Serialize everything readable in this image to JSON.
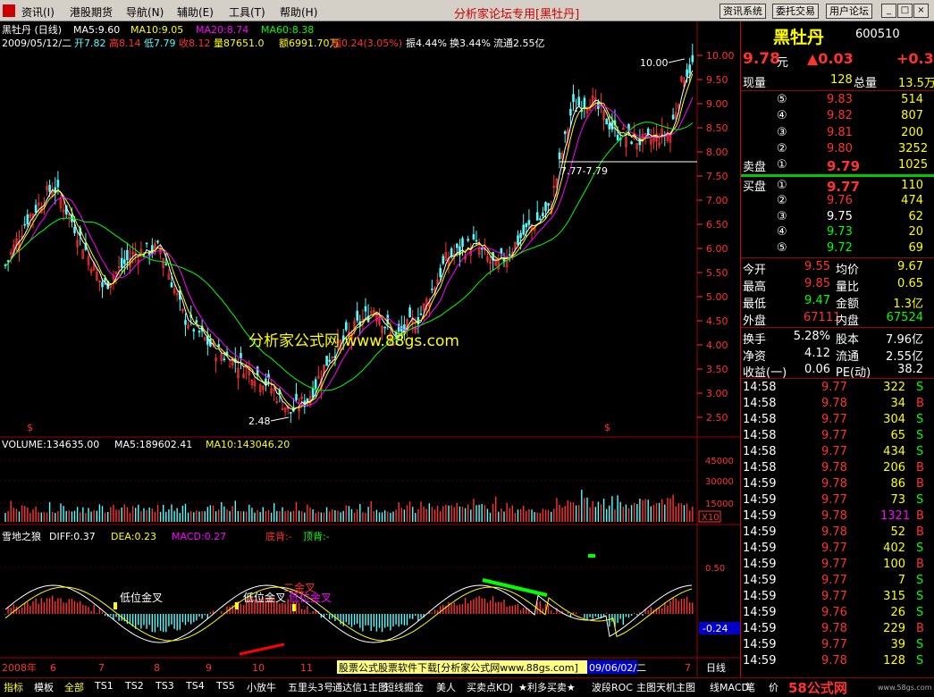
{
  "menu": {
    "items": [
      "资讯(I)",
      "港股期货",
      "导航(N)",
      "辅助(E)",
      "工具(T)",
      "帮助(H)"
    ],
    "title_prefix": "分析家论坛专用",
    "title_stock": "[黑牡丹]",
    "buttons": [
      "资讯系统",
      "委托交易",
      "用户论坛"
    ],
    "window_buttons": [
      "_",
      "□",
      "×"
    ]
  },
  "price_panel": {
    "line1": {
      "name": "黑牡丹  (日线)",
      "ma5": "MA5:9.60",
      "ma10": "MA10:9.05",
      "ma20": "MA20:8.74",
      "ma60": "MA60:8.38"
    },
    "line2": {
      "date": "2009/05/12/二",
      "open": "开7.82",
      "high": "高8.14",
      "low": "低7.79",
      "close": "收8.12",
      "volume": "量87651.0",
      "amount": "额6991.70万",
      "range": "幅0.24(3.05%)",
      "amplitude": "振4.44%",
      "turnover": "换3.44%",
      "float": "流通2.55亿"
    },
    "annotations": {
      "high_mark": "10.00",
      "low_mark": "2.48",
      "range_box": "7.77-7.79",
      "watermark": "分析家公式网 www.88gs.com",
      "dollar_left": "$",
      "dollar_right": "$"
    },
    "y_ticks": [
      "10.00",
      "9.50",
      "9.00",
      "8.50",
      "8.00",
      "7.50",
      "7.00",
      "6.50",
      "6.00",
      "5.50",
      "5.00",
      "4.50",
      "4.00",
      "3.50",
      "3.00",
      "2.50"
    ]
  },
  "volume_panel": {
    "label": "VOLUME:134635.00",
    "ma5": "MA5:189602.41",
    "ma10": "MA10:143046.20",
    "y_ticks": [
      "45000",
      "30000",
      "15000"
    ],
    "unit": "X10"
  },
  "indicator_panel": {
    "name": "雪地之狼",
    "diff": "DIFF:0.37",
    "dea": "DEA:0.23",
    "macd": "MACD:0.27",
    "bottom_div": "底背:-",
    "top_div": "顶背:-",
    "notes": [
      "低位金叉",
      "低位金叉",
      "二金叉",
      "低位金叉"
    ],
    "y_tick": "0.50",
    "current_value": "-0.24"
  },
  "x_axis": {
    "labels": [
      "2008年",
      "6",
      "7",
      "8",
      "9",
      "10",
      "11",
      "7"
    ],
    "scroll_text": "股票公式股票软件下载[分析家公式网www.88gs.com]",
    "cursor_date": "09/06/02/二",
    "period": "日线"
  },
  "quote": {
    "name": "黑牡丹",
    "code": "600510",
    "price": "9.78",
    "price_unit": "元",
    "change": "▲0.03",
    "change2": "+0.31",
    "volume_now_label": "现量",
    "volume_now": "128",
    "volume_total_label": "总量",
    "volume_total": "13.5万",
    "sell": [
      {
        "lvl": "⑤",
        "price": "9.83",
        "vol": "514"
      },
      {
        "lvl": "④",
        "price": "9.82",
        "vol": "807"
      },
      {
        "lvl": "③",
        "price": "9.81",
        "vol": "200"
      },
      {
        "lvl": "②",
        "price": "9.80",
        "vol": "3252"
      },
      {
        "lvl": "①",
        "price": "9.79",
        "vol": "1025"
      }
    ],
    "sell_label": "卖盘",
    "buy_label": "买盘",
    "buy": [
      {
        "lvl": "①",
        "price": "9.77",
        "vol": "110"
      },
      {
        "lvl": "②",
        "price": "9.76",
        "vol": "474"
      },
      {
        "lvl": "③",
        "price": "9.75",
        "vol": "62"
      },
      {
        "lvl": "④",
        "price": "9.73",
        "vol": "20"
      },
      {
        "lvl": "⑤",
        "price": "9.72",
        "vol": "69"
      }
    ],
    "stats": [
      {
        "l1": "今开",
        "v1": "9.55",
        "l2": "均价",
        "v2": "9.67"
      },
      {
        "l1": "最高",
        "v1": "9.85",
        "l2": "量比",
        "v2": "0.65"
      },
      {
        "l1": "最低",
        "v1": "9.47",
        "l2": "金额",
        "v2": "1.3亿"
      },
      {
        "l1": "外盘",
        "v1": "67111",
        "l2": "内盘",
        "v2": "67524"
      }
    ],
    "fund": [
      {
        "l1": "换手",
        "v1": "5.28%",
        "l2": "股本",
        "v2": "7.96亿"
      },
      {
        "l1": "净资",
        "v1": "4.12",
        "l2": "流通",
        "v2": "2.55亿"
      },
      {
        "l1": "收益(一)",
        "v1": "0.06",
        "l2": "PE(动)",
        "v2": "38.2"
      }
    ],
    "ticks": [
      {
        "t": "14:58",
        "p": "9.77",
        "v": "322",
        "s": "S"
      },
      {
        "t": "14:58",
        "p": "9.78",
        "v": "34",
        "s": "B"
      },
      {
        "t": "14:58",
        "p": "9.77",
        "v": "304",
        "s": "S"
      },
      {
        "t": "14:58",
        "p": "9.77",
        "v": "65",
        "s": "S"
      },
      {
        "t": "14:58",
        "p": "9.77",
        "v": "434",
        "s": "S"
      },
      {
        "t": "14:58",
        "p": "9.78",
        "v": "206",
        "s": "B"
      },
      {
        "t": "14:59",
        "p": "9.78",
        "v": "86",
        "s": "B"
      },
      {
        "t": "14:59",
        "p": "9.77",
        "v": "73",
        "s": "S"
      },
      {
        "t": "14:59",
        "p": "9.78",
        "v": "1321",
        "s": "B"
      },
      {
        "t": "14:59",
        "p": "9.78",
        "v": "52",
        "s": "B"
      },
      {
        "t": "14:59",
        "p": "9.77",
        "v": "402",
        "s": "S"
      },
      {
        "t": "14:59",
        "p": "9.77",
        "v": "100",
        "s": "B"
      },
      {
        "t": "14:59",
        "p": "9.77",
        "v": "7",
        "s": "S"
      },
      {
        "t": "14:59",
        "p": "9.77",
        "v": "315",
        "s": "S"
      },
      {
        "t": "14:59",
        "p": "9.76",
        "v": "26",
        "s": "S"
      },
      {
        "t": "14:59",
        "p": "9.78",
        "v": "229",
        "s": "B"
      },
      {
        "t": "14:59",
        "p": "9.77",
        "v": "39",
        "s": "S"
      },
      {
        "t": "14:59",
        "p": "9.78",
        "v": "128",
        "s": "S"
      }
    ]
  },
  "tabs": [
    "指标",
    "模板",
    "全部",
    "TS1",
    "TS2",
    "TS3",
    "TS4",
    "TS5",
    "小放牛",
    "五里头3号",
    "通达信1主图",
    "短线掘金",
    "美人",
    "买卖点KDJ",
    "★利多买卖★",
    "波段ROC",
    "主图天机主图",
    "线MACD"
  ],
  "bottom_right": {
    "b1": "笔",
    "b2": "价",
    "logo": "58公式网",
    "logo_url": "www.58gs.com"
  },
  "colors": {
    "up": "#ff3232",
    "down": "#54fcfc",
    "ma5": "#ffffff",
    "ma10": "#ffff00",
    "ma20": "#ff00ff",
    "ma60": "#00ff00",
    "grid": "#800000"
  }
}
